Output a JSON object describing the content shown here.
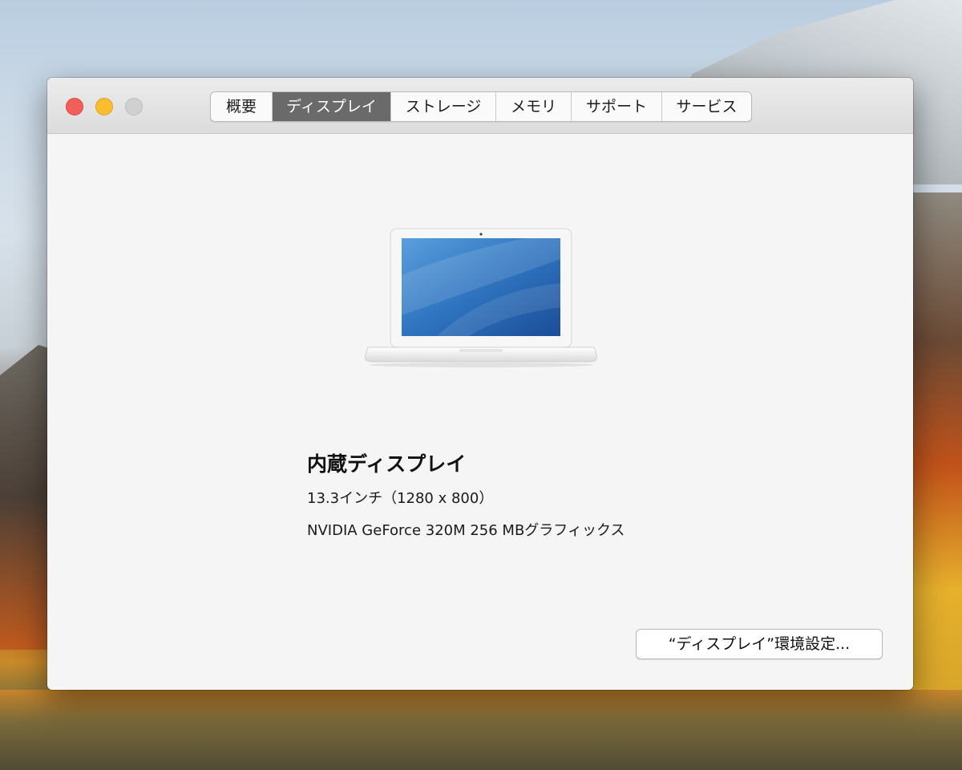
{
  "window": {
    "tabs": [
      {
        "label": "概要",
        "active": false
      },
      {
        "label": "ディスプレイ",
        "active": true
      },
      {
        "label": "ストレージ",
        "active": false
      },
      {
        "label": "メモリ",
        "active": false
      },
      {
        "label": "サポート",
        "active": false
      },
      {
        "label": "サービス",
        "active": false
      }
    ]
  },
  "display": {
    "name": "内蔵ディスプレイ",
    "size": "13.3インチ（1280 x 800）",
    "graphics": "NVIDIA GeForce 320M 256 MBグラフィックス"
  },
  "actions": {
    "display_prefs_label": "“ディスプレイ”環境設定..."
  },
  "icons": {
    "close": "close-traffic-light-icon",
    "minimize": "minimize-traffic-light-icon",
    "zoom": "zoom-traffic-light-icon",
    "laptop": "macbook-icon"
  },
  "colors": {
    "close": "#f25f58",
    "minimize": "#f9bd2e",
    "zoom_disabled": "#d0d0d0",
    "active_tab": "#6a6a6a"
  }
}
